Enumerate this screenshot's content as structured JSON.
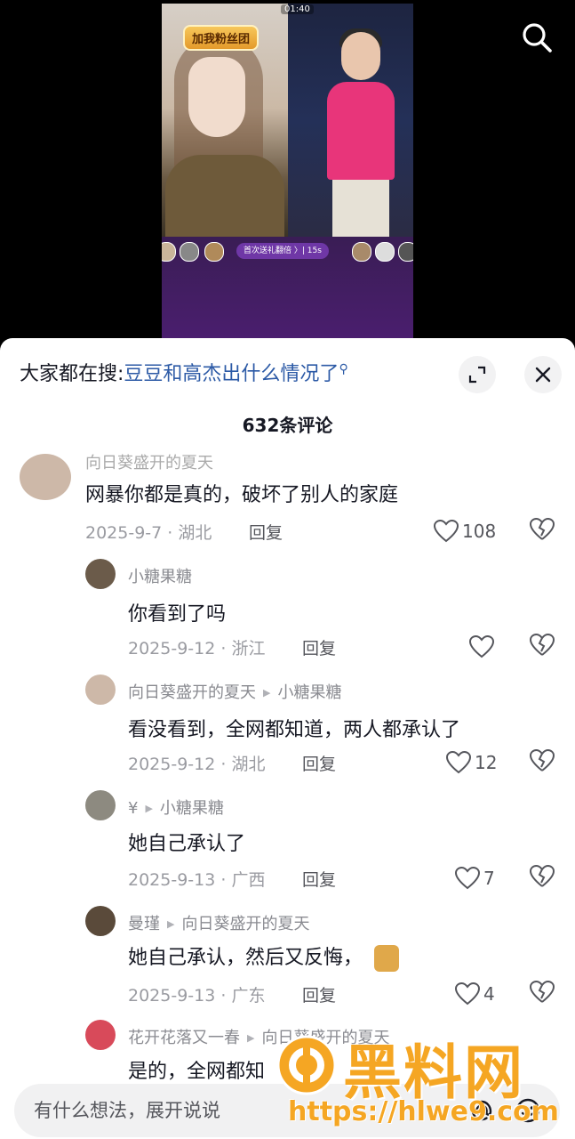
{
  "video": {
    "status_time": "01:40",
    "fan_badge": "加我粉丝团",
    "gift_text": "首次送礼翻倍 〉| 15s"
  },
  "sheet": {
    "search_prefix": "大家都在搜:",
    "search_query": "豆豆和高杰出什么情况了",
    "comment_count": "632条评论"
  },
  "comments": [
    {
      "user": "向日葵盛开的夏天",
      "text": "网暴你都是真的，破坏了别人的家庭",
      "date_loc": "2025-9-7 · 湖北",
      "reply": "回复",
      "likes": "108",
      "avatar_color": "#cdb8a8"
    },
    {
      "user": "小糖果糖",
      "text": "你看到了吗",
      "date_loc": "2025-9-12 · 浙江",
      "reply": "回复",
      "likes": "",
      "avatar_color": "#6b5b4a"
    },
    {
      "user": "向日葵盛开的夏天",
      "reply_to": "小糖果糖",
      "text": "看没看到，全网都知道，两人都承认了",
      "date_loc": "2025-9-12 · 湖北",
      "reply": "回复",
      "likes": "12",
      "avatar_color": "#cdb8a8"
    },
    {
      "user": "¥",
      "reply_to": "小糖果糖",
      "text": "她自己承认了",
      "date_loc": "2025-9-13 · 广西",
      "reply": "回复",
      "likes": "7",
      "avatar_color": "#8d8a80"
    },
    {
      "user": "曼瑾",
      "reply_to": "向日葵盛开的夏天",
      "text": "她自己承认，然后又反悔，",
      "date_loc": "2025-9-13 · 广东",
      "reply": "回复",
      "likes": "4",
      "avatar_color": "#5a4a3a"
    },
    {
      "user": "花开花落又一春",
      "reply_to": "向日葵盛开的夏天",
      "text": "是的，全网都知",
      "avatar_color": "#d84a5a"
    }
  ],
  "input": {
    "placeholder": "有什么想法，展开说说"
  },
  "watermark": {
    "title": "黑料网",
    "url": "https://hlwe9.com"
  },
  "colors": {
    "accent_link": "#2c5aa6",
    "watermark": "#f5a623"
  },
  "icons": [
    "search-icon",
    "expand-icon",
    "close-icon",
    "heart-icon",
    "broken-heart-icon",
    "at-icon",
    "emoji-icon"
  ]
}
